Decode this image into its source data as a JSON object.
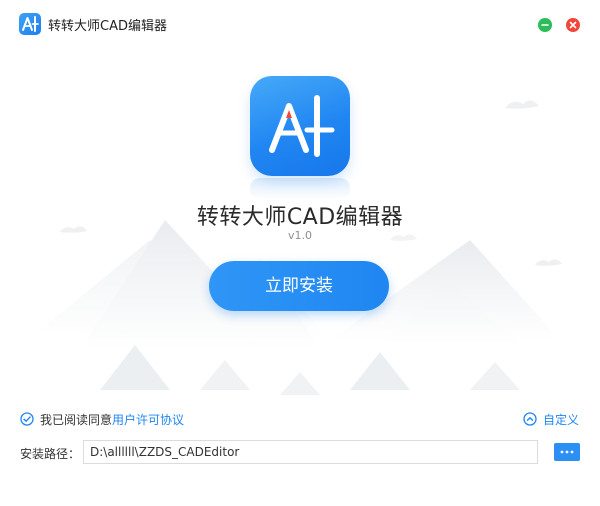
{
  "window": {
    "title": "转转大师CAD编辑器",
    "controls": {
      "minimize_icon": "minimize-icon",
      "close_icon": "close-icon"
    }
  },
  "app": {
    "name": "转转大师CAD编辑器",
    "version": "v1.0",
    "logo_icon": "app-logo-icon"
  },
  "actions": {
    "install_label": "立即安装"
  },
  "agreement": {
    "prefix": "我已阅读同意",
    "link_label": "用户许可协议",
    "checked": true
  },
  "custom": {
    "label": "自定义"
  },
  "install_path": {
    "label": "安装路径：",
    "value": "D:\\allllll\\ZZDS_CADEditor",
    "browse_icon": "more-icon"
  },
  "colors": {
    "accent": "#1f86f2",
    "minimize": "#2cbc5a",
    "close": "#f0463c"
  }
}
